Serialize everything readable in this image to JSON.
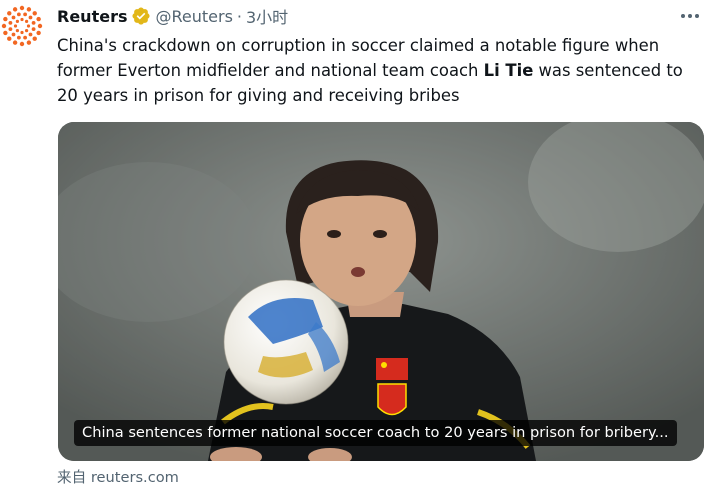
{
  "author": {
    "name": "Reuters",
    "handle": "@Reuters",
    "separator": "·",
    "time": "3小时",
    "avatar_icon": "reuters-logo",
    "verified_icon": "verified-badge-icon",
    "verified_color": "#e2b719"
  },
  "tweet": {
    "text_before": "China's crackdown on corruption in soccer claimed a notable figure when former Everton midfielder and national team coach ",
    "text_bold": "Li Tie",
    "text_after": " was sentenced to 20 years in prison for giving and receiving bribes"
  },
  "card": {
    "title": "China sentences former national soccer coach to 20 years in prison for bribery...",
    "source_prefix": "来自",
    "source_domain": "reuters.com"
  },
  "colors": {
    "text": "#0f1419",
    "secondary": "#536471",
    "brand_orange": "#f26722"
  }
}
